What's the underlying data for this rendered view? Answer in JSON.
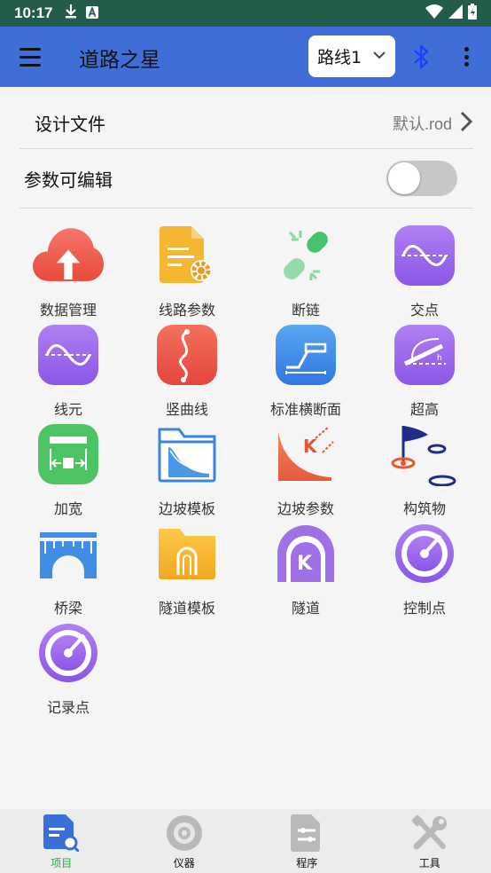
{
  "status_bar": {
    "time": "10:17"
  },
  "app_bar": {
    "title": "道路之星",
    "route_select": "路线1"
  },
  "design_file": {
    "label": "设计文件",
    "value": "默认.rod"
  },
  "editable": {
    "label": "参数可编辑",
    "enabled": false
  },
  "grid": [
    {
      "label": "数据管理",
      "icon": "cloud-upload-icon"
    },
    {
      "label": "线路参数",
      "icon": "document-gear-icon"
    },
    {
      "label": "断链",
      "icon": "broken-link-icon"
    },
    {
      "label": "交点",
      "icon": "sine-wave-icon"
    },
    {
      "label": "线元",
      "icon": "sine-wave-icon"
    },
    {
      "label": "竖曲线",
      "icon": "vertical-curve-icon"
    },
    {
      "label": "标准横断面",
      "icon": "cross-section-icon"
    },
    {
      "label": "超高",
      "icon": "superelevation-icon"
    },
    {
      "label": "加宽",
      "icon": "widening-icon"
    },
    {
      "label": "边坡模板",
      "icon": "slope-template-folder-icon"
    },
    {
      "label": "边坡参数",
      "icon": "slope-parameter-icon"
    },
    {
      "label": "构筑物",
      "icon": "flag-structure-icon"
    },
    {
      "label": "桥梁",
      "icon": "bridge-icon"
    },
    {
      "label": "隧道模板",
      "icon": "tunnel-template-folder-icon"
    },
    {
      "label": "隧道",
      "icon": "tunnel-icon"
    },
    {
      "label": "控制点",
      "icon": "target-icon"
    },
    {
      "label": "记录点",
      "icon": "target-icon"
    }
  ],
  "bottom_nav": [
    {
      "label": "项目",
      "icon": "project-icon",
      "active": true
    },
    {
      "label": "仪器",
      "icon": "instrument-icon",
      "active": false
    },
    {
      "label": "程序",
      "icon": "program-icon",
      "active": false
    },
    {
      "label": "工具",
      "icon": "tools-icon",
      "active": false
    }
  ],
  "colors": {
    "status_bar": "#245c4c",
    "app_bar": "#3f6fd6",
    "active_nav": "#2aa84a"
  }
}
